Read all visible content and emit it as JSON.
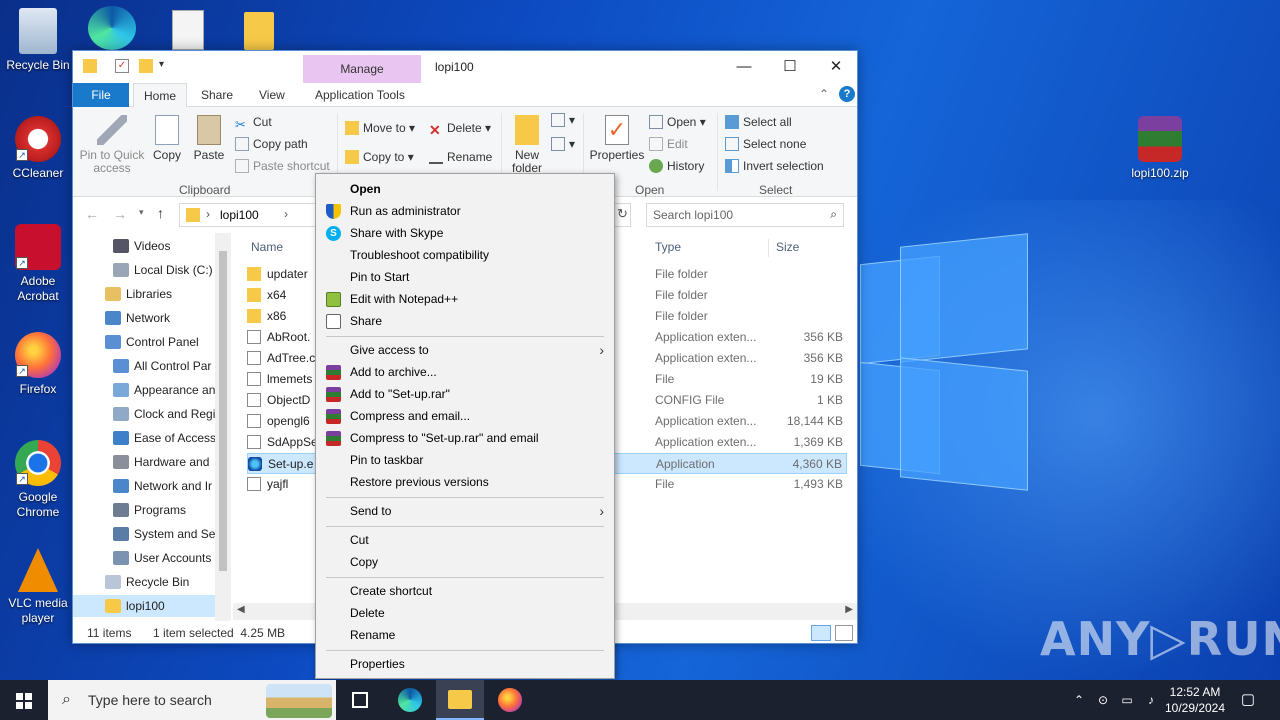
{
  "desktop": {
    "icons": [
      {
        "label": "Recycle Bin"
      },
      {
        "label": "CCleaner"
      },
      {
        "label": "Adobe Acrobat"
      },
      {
        "label": "Firefox"
      },
      {
        "label": "Google Chrome"
      },
      {
        "label": "VLC media player"
      },
      {
        "label": "lopi100.zip"
      }
    ],
    "watermark": "ANY▷RUN"
  },
  "window": {
    "manage_tab": "Manage",
    "title": "lopi100",
    "ribbon_tabs": [
      "File",
      "Home",
      "Share",
      "View",
      "Application Tools"
    ],
    "clipboard": {
      "pin": "Pin to Quick access",
      "copy": "Copy",
      "paste": "Paste",
      "cut": "Cut",
      "copy_path": "Copy path",
      "paste_shortcut": "Paste shortcut",
      "group": "Clipboard"
    },
    "organize": {
      "move_to": "Move to",
      "copy_to": "Copy to",
      "delete": "Delete",
      "rename": "Rename"
    },
    "new": {
      "new_folder_line1": "New",
      "new_folder_line2": "folder"
    },
    "open": {
      "properties": "Properties",
      "open": "Open",
      "edit": "Edit",
      "history": "History",
      "group": "Open"
    },
    "select": {
      "select_all": "Select all",
      "select_none": "Select none",
      "invert": "Invert selection",
      "group": "Select"
    },
    "address": {
      "path": "lopi100",
      "search_placeholder": "Search lopi100"
    },
    "nav_tree": [
      "Videos",
      "Local Disk (C:)",
      "Libraries",
      "Network",
      "Control Panel",
      "All Control Par",
      "Appearance an",
      "Clock and Regi",
      "Ease of Access",
      "Hardware and",
      "Network and Ir",
      "Programs",
      "System and Sec",
      "User Accounts",
      "Recycle Bin",
      "lopi100"
    ],
    "columns": {
      "name": "Name",
      "type": "Type",
      "size": "Size"
    },
    "files": [
      {
        "name": "updater",
        "type": "File folder",
        "size": ""
      },
      {
        "name": "x64",
        "type": "File folder",
        "size": ""
      },
      {
        "name": "x86",
        "type": "File folder",
        "size": ""
      },
      {
        "name": "AbRoot.",
        "type": "Application exten...",
        "size": "356 KB"
      },
      {
        "name": "AdTree.c",
        "type": "Application exten...",
        "size": "356 KB"
      },
      {
        "name": "lmemets",
        "type": "File",
        "size": "19 KB"
      },
      {
        "name": "ObjectD",
        "type": "CONFIG File",
        "size": "1 KB"
      },
      {
        "name": "opengl6",
        "type": "Application exten...",
        "size": "18,144 KB"
      },
      {
        "name": "SdAppSe",
        "type": "Application exten...",
        "size": "1,369 KB"
      },
      {
        "name": "Set-up.e",
        "type": "Application",
        "size": "4,360 KB"
      },
      {
        "name": "yajfl",
        "type": "File",
        "size": "1,493 KB"
      }
    ],
    "status": {
      "count": "11 items",
      "selected": "1 item selected  4.25 MB"
    }
  },
  "context_menu": {
    "items": [
      "Open",
      "Run as administrator",
      "Share with Skype",
      "Troubleshoot compatibility",
      "Pin to Start",
      "Edit with Notepad++",
      "Share",
      "Give access to",
      "Add to archive...",
      "Add to \"Set-up.rar\"",
      "Compress and email...",
      "Compress to \"Set-up.rar\" and email",
      "Pin to taskbar",
      "Restore previous versions",
      "Send to",
      "Cut",
      "Copy",
      "Create shortcut",
      "Delete",
      "Rename",
      "Properties"
    ]
  },
  "taskbar": {
    "search_placeholder": "Type here to search",
    "time": "12:52 AM",
    "date": "10/29/2024"
  }
}
